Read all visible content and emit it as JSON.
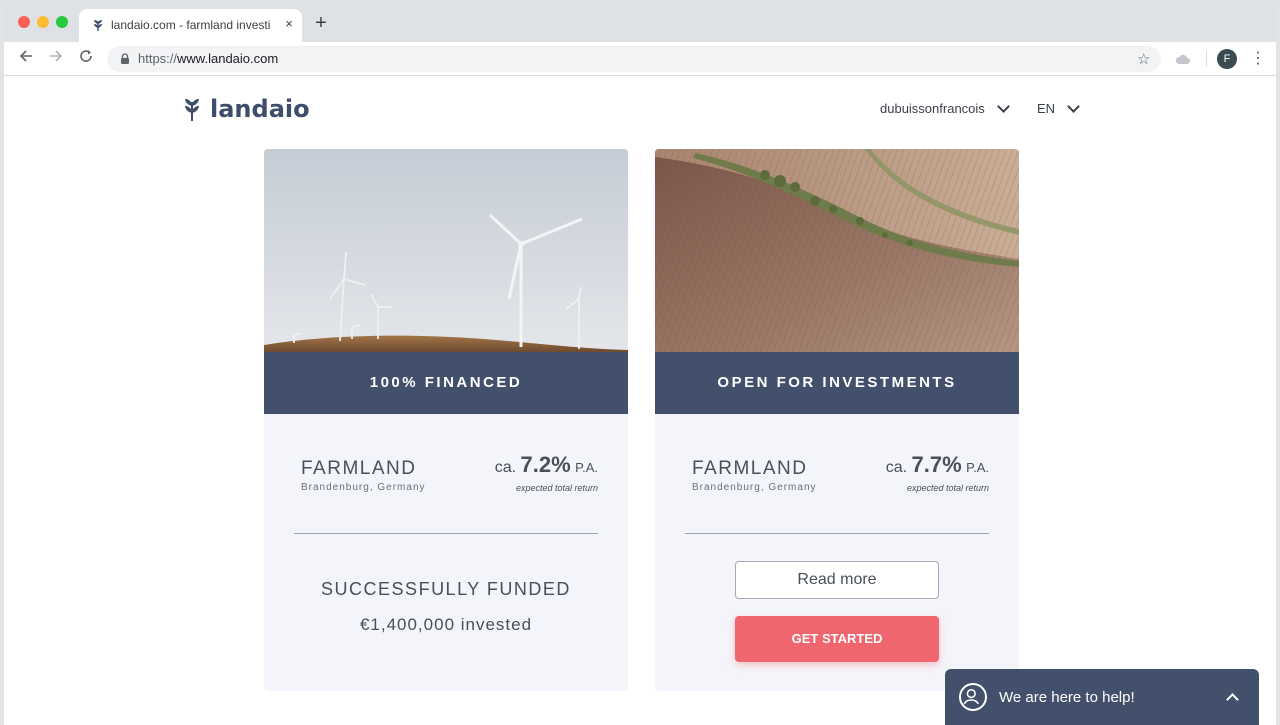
{
  "browser": {
    "tab_title": "landaio.com - farmland investi",
    "tab_close": "×",
    "new_tab": "+",
    "url_scheme": "https://",
    "url_host": "www.landaio.com",
    "profile_initial": "F"
  },
  "site": {
    "logo_text": "landaio",
    "user_menu_label": "dubuissonfrancois",
    "language_label": "EN",
    "brand_color": "#43506b",
    "cta_color": "#f0666e"
  },
  "cards": [
    {
      "banner": "100% FINANCED",
      "asset_title": "FARMLAND",
      "location": "Brandenburg, Germany",
      "return_prefix": "ca.",
      "return_value": "7.2%",
      "return_suffix": "P.A.",
      "return_note": "expected total return",
      "status_title": "SUCCESSFULLY FUNDED",
      "status_amount": "€1,400,000 invested",
      "image": "wind-turbines-photo"
    },
    {
      "banner": "OPEN FOR INVESTMENTS",
      "asset_title": "FARMLAND",
      "location": "Brandenburg, Germany",
      "return_prefix": "ca.",
      "return_value": "7.7%",
      "return_suffix": "P.A.",
      "return_note": "expected total return",
      "read_more_label": "Read more",
      "get_started_label": "GET STARTED",
      "image": "plowed-field-photo"
    }
  ],
  "chat": {
    "label": "We are here to help!"
  }
}
